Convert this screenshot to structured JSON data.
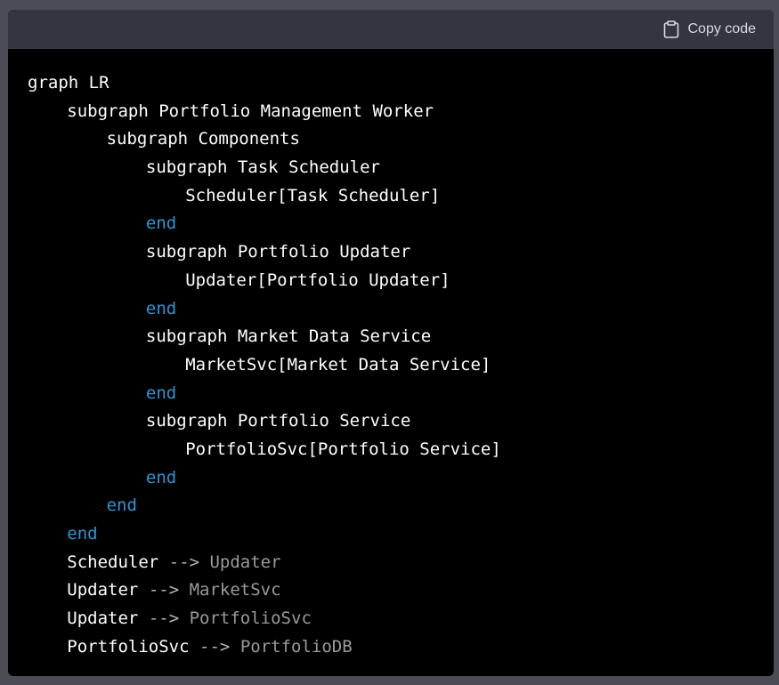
{
  "header": {
    "copy_label": "Copy code",
    "icon": "clipboard-icon"
  },
  "colors": {
    "page_background": "#4b4c55",
    "code_background": "#000000",
    "header_background": "#343541",
    "end_keyword": "#2e95d3",
    "edge_target": "#9a9a9a"
  },
  "code": {
    "lines": [
      {
        "indent": 0,
        "text": "graph LR",
        "kind": "plain"
      },
      {
        "indent": 1,
        "text": "subgraph Portfolio Management Worker",
        "kind": "plain"
      },
      {
        "indent": 2,
        "text": "subgraph Components",
        "kind": "plain"
      },
      {
        "indent": 3,
        "text": "subgraph Task Scheduler",
        "kind": "plain"
      },
      {
        "indent": 4,
        "text": "Scheduler[Task Scheduler]",
        "kind": "plain"
      },
      {
        "indent": 3,
        "text": "end",
        "kind": "end"
      },
      {
        "indent": 3,
        "text": "subgraph Portfolio Updater",
        "kind": "plain"
      },
      {
        "indent": 4,
        "text": "Updater[Portfolio Updater]",
        "kind": "plain"
      },
      {
        "indent": 3,
        "text": "end",
        "kind": "end"
      },
      {
        "indent": 3,
        "text": "subgraph Market Data Service",
        "kind": "plain"
      },
      {
        "indent": 4,
        "text": "MarketSvc[Market Data Service]",
        "kind": "plain"
      },
      {
        "indent": 3,
        "text": "end",
        "kind": "end"
      },
      {
        "indent": 3,
        "text": "subgraph Portfolio Service",
        "kind": "plain"
      },
      {
        "indent": 4,
        "text": "PortfolioSvc[Portfolio Service]",
        "kind": "plain"
      },
      {
        "indent": 3,
        "text": "end",
        "kind": "end"
      },
      {
        "indent": 2,
        "text": "end",
        "kind": "end"
      },
      {
        "indent": 1,
        "text": "end",
        "kind": "end"
      },
      {
        "indent": 1,
        "kind": "edge",
        "source": "Scheduler",
        "arrow": "-->",
        "target": "Updater"
      },
      {
        "indent": 1,
        "kind": "edge",
        "source": "Updater",
        "arrow": "-->",
        "target": "MarketSvc"
      },
      {
        "indent": 1,
        "kind": "edge",
        "source": "Updater",
        "arrow": "-->",
        "target": "PortfolioSvc"
      },
      {
        "indent": 1,
        "kind": "edge",
        "source": "PortfolioSvc",
        "arrow": "-->",
        "target": "PortfolioDB"
      }
    ]
  }
}
